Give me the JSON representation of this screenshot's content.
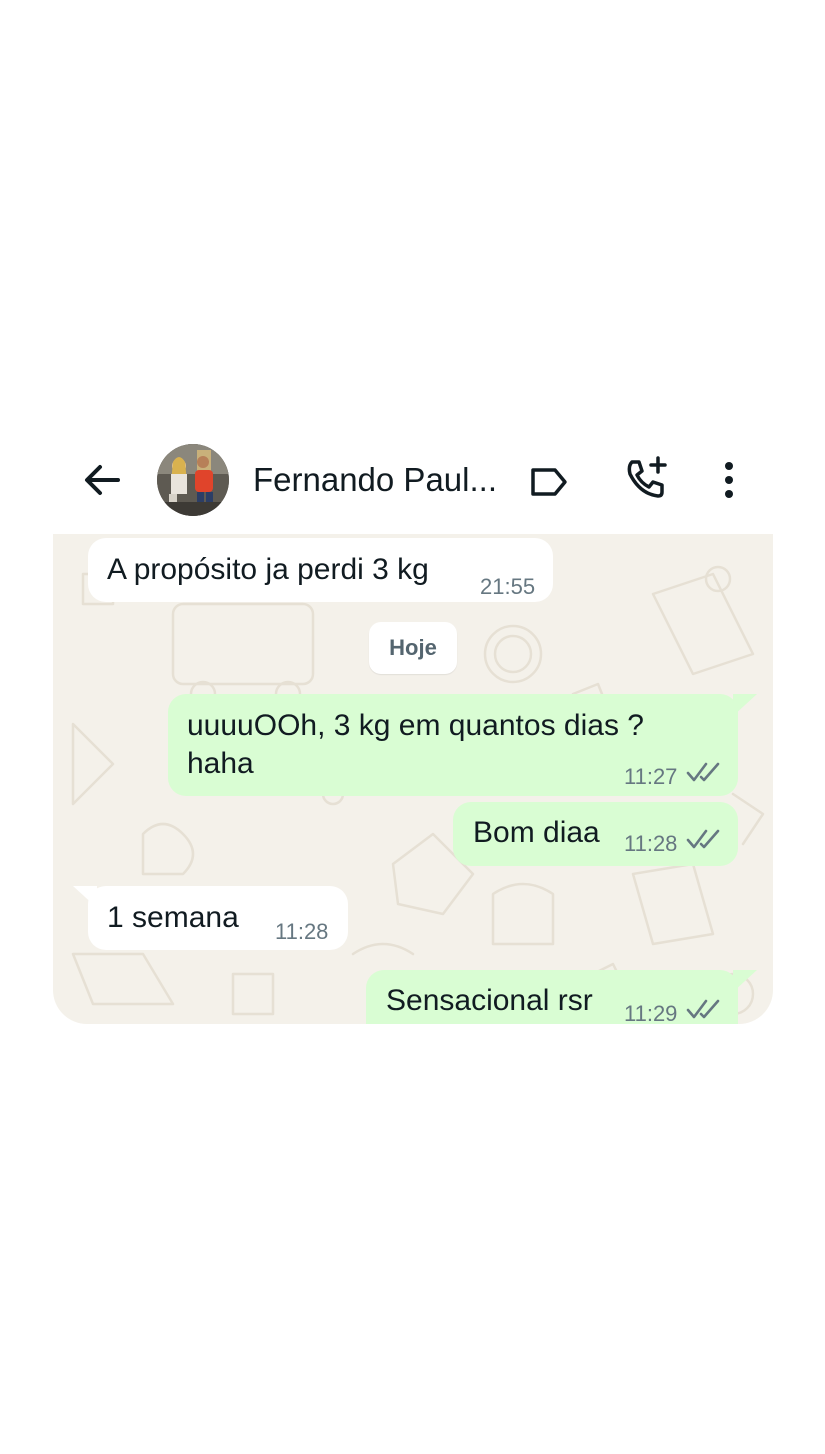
{
  "header": {
    "contact_name": "Fernando Paul...",
    "icons": {
      "back": "arrow-left-icon",
      "label": "label-tag-icon",
      "call": "add-call-icon",
      "menu": "more-vertical-icon"
    }
  },
  "date_divider": "Hoje",
  "messages": [
    {
      "direction": "incoming",
      "text": "A propósito ja perdi 3 kg",
      "time": "21:55"
    },
    {
      "direction": "outgoing",
      "text_lines": [
        "uuuuOOh, 3 kg em quantos dias ?",
        "haha"
      ],
      "time": "11:27",
      "status": "read"
    },
    {
      "direction": "outgoing",
      "text": "Bom diaa",
      "time": "11:28",
      "status": "read"
    },
    {
      "direction": "incoming",
      "text": "1 semana",
      "time": "11:28"
    },
    {
      "direction": "outgoing",
      "text": "Sensacional rsr",
      "time": "11:29",
      "status": "read"
    }
  ],
  "colors": {
    "outgoing_bubble": "#d9fdd3",
    "incoming_bubble": "#ffffff",
    "chat_background": "#f4f1ea",
    "read_ticks": "#667781"
  }
}
